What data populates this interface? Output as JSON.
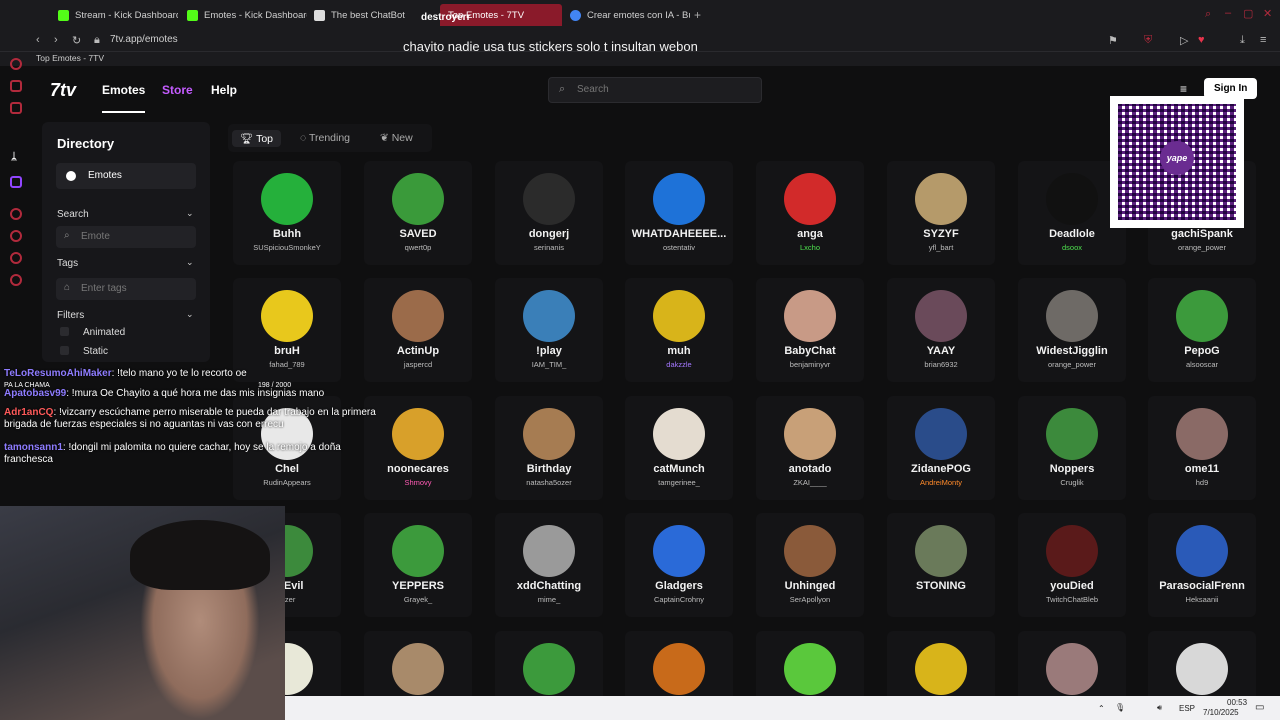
{
  "browser": {
    "tabs": [
      {
        "label": "Stream - Kick Dashboard",
        "color": "#53fc18"
      },
      {
        "label": "Emotes - Kick Dashboard",
        "color": "#53fc18"
      },
      {
        "label": "The best ChatBot",
        "color": "#ffffff"
      },
      {
        "label": "Top Emotes - 7TV",
        "color": "#ffffff"
      },
      {
        "label": "Crear emotes con IA - Bu",
        "color": "#4285f4"
      }
    ],
    "overlay_tab_text": "destroyerr",
    "url": "7tv.app/emotes",
    "bookmark": "Top Emotes - 7TV"
  },
  "stream": {
    "title": "chayito nadie usa tus stickers solo t insultan webon"
  },
  "header": {
    "logo": "7tv",
    "nav": [
      "Emotes",
      "Store",
      "Help"
    ],
    "search_placeholder": "Search",
    "signin": "Sign In"
  },
  "directory": {
    "title": "Directory",
    "emotes_label": "Emotes",
    "search_label": "Search",
    "search_placeholder": "Emote",
    "tags_label": "Tags",
    "tags_placeholder": "Enter tags",
    "filters_label": "Filters",
    "filter_options": [
      "Animated",
      "Static"
    ]
  },
  "filter_tabs": [
    "Top",
    "Trending",
    "New"
  ],
  "emotes": [
    [
      {
        "name": "Buhh",
        "author": "SUSpiciouSmonkeY",
        "color": "#25b03b"
      },
      {
        "name": "SAVED",
        "author": "qwert0p",
        "color": "#3a9a3a"
      },
      {
        "name": "dongerj",
        "author": "serinanis",
        "color": "#2b2b2b"
      },
      {
        "name": "WHATDAHEEEE...",
        "author": "ostentativ",
        "color": "#1e72d8"
      },
      {
        "name": "anga",
        "author": "Lxcho",
        "color": "#d22a2a",
        "author_color": "#4de04d"
      },
      {
        "name": "SYZYF",
        "author": "yfl_bart",
        "color": "#b59a6a"
      },
      {
        "name": "Deadlole",
        "author": "dsoox",
        "color": "#111111",
        "author_color": "#4de04d"
      },
      {
        "name": "gachiSpank",
        "author": "orange_power",
        "color": "#c08a5c"
      }
    ],
    [
      {
        "name": "bruH",
        "author": "fahad_789",
        "color": "#e8c81c"
      },
      {
        "name": "ActinUp",
        "author": "jaspercd",
        "color": "#9b6b4a"
      },
      {
        "name": "!play",
        "author": "IAM_TIM_",
        "color": "#3a7fb8"
      },
      {
        "name": "muh",
        "author": "dakzzle",
        "color": "#d8b41a",
        "author_color": "#a478ff"
      },
      {
        "name": "BabyChat",
        "author": "benjaminyvr",
        "color": "#c89a86"
      },
      {
        "name": "YAAY",
        "author": "brian6932",
        "color": "#6a4a5a"
      },
      {
        "name": "WidestJigglin",
        "author": "orange_power",
        "color": "#6e6a66"
      },
      {
        "name": "PepoG",
        "author": "alsooscar",
        "color": "#3c9a3c"
      }
    ],
    [
      {
        "name": "Chel",
        "author": "RudinAppears",
        "color": "#e8e8e8"
      },
      {
        "name": "noonecares",
        "author": "Shmovy",
        "color": "#d8a02a",
        "author_color": "#ff5ab4"
      },
      {
        "name": "Birthday",
        "author": "natasha5ozer",
        "color": "#a67c52"
      },
      {
        "name": "catMunch",
        "author": "tamgerinee_",
        "color": "#e4dcd0"
      },
      {
        "name": "anotado",
        "author": "ZKAI____",
        "color": "#c8a078"
      },
      {
        "name": "ZidanePOG",
        "author": "AndreiMonty",
        "color": "#2a4c8a",
        "author_color": "#ff8a2a"
      },
      {
        "name": "Noppers",
        "author": "Cruglik",
        "color": "#3c8a3c"
      },
      {
        "name": "ome11",
        "author": "hd9",
        "color": "#8a6a66"
      }
    ],
    [
      {
        "name": "ooEvil",
        "author": "ntzer",
        "color": "#3c8a3c"
      },
      {
        "name": "YEPPERS",
        "author": "Grayek_",
        "color": "#3c9a3c"
      },
      {
        "name": "xddChatting",
        "author": "mime_",
        "color": "#9a9a9a"
      },
      {
        "name": "Gladgers",
        "author": "CaptainCrohny",
        "color": "#2a6ad8"
      },
      {
        "name": "Unhinged",
        "author": "SerApollyon",
        "color": "#8a5a3a"
      },
      {
        "name": "STONING",
        "author": "",
        "color": "#6a7a5a"
      },
      {
        "name": "youDied",
        "author": "TwitchChatBleb",
        "color": "#5a1a1a"
      },
      {
        "name": "ParasocialFrenn",
        "author": "Heksaanii",
        "color": "#2a5ab8"
      }
    ],
    [
      {
        "name": "",
        "author": "",
        "color": "#e8e8d8"
      },
      {
        "name": "",
        "author": "",
        "color": "#a88a6a"
      },
      {
        "name": "",
        "author": "",
        "color": "#3c9a3c"
      },
      {
        "name": "",
        "author": "",
        "color": "#c86a1a"
      },
      {
        "name": "",
        "author": "",
        "color": "#5ac83c"
      },
      {
        "name": "",
        "author": "",
        "color": "#d8b41a"
      },
      {
        "name": "",
        "author": "",
        "color": "#9a7a7a"
      },
      {
        "name": "",
        "author": "",
        "color": "#d8d8d8"
      }
    ]
  ],
  "chat": [
    {
      "user": "TeLoResumoAhiMaker",
      "text": ": !telo mano yo te lo recorto oe",
      "red": false
    },
    {
      "user": "Apatobasv99",
      "text": ": !mura Oe Chayito a qué hora me das mis insignias mano",
      "red": false
    },
    {
      "user": "Adr1anCQ",
      "text": ": !vizcarry escúchame perro miserable te pueda dar trabajo en la primera brigada de fuerzas especiales si no aguantas ni vas con errecu",
      "red": true
    },
    {
      "user": "tamonsann1",
      "text": ": !dongil mi palomita no quiere cachar, hoy se la remojo a doña franchesca",
      "red": false
    }
  ],
  "chat_extra": {
    "label": "PA LA CHAMA",
    "count": "198 / 2000"
  },
  "qr_brand": "yape",
  "taskbar": {
    "lang": "ESP",
    "time": "00:53",
    "date": "7/10/2025"
  }
}
